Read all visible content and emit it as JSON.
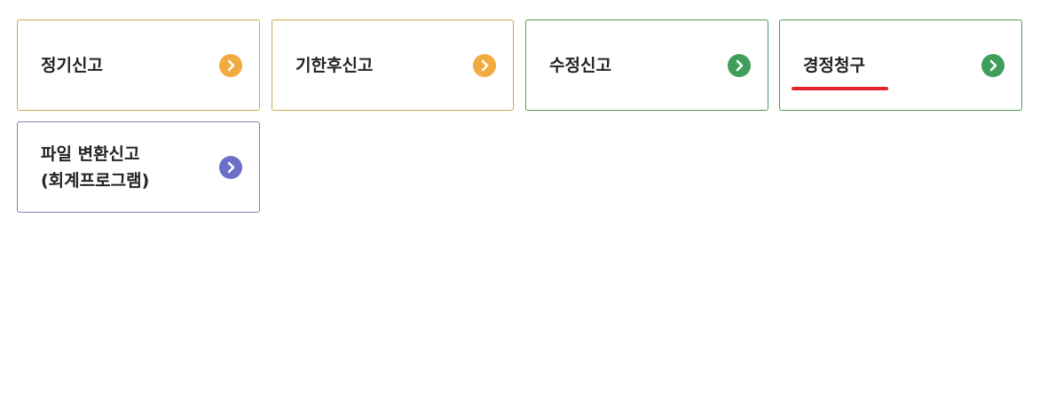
{
  "cards": [
    {
      "lines": [
        "정기신고"
      ],
      "color": "#f2ab3e",
      "theme": "orange",
      "icon": "chevron-right-icon"
    },
    {
      "lines": [
        "기한후신고"
      ],
      "color": "#f2ab3e",
      "theme": "orange",
      "icon": "chevron-right-icon"
    },
    {
      "lines": [
        "수정신고"
      ],
      "color": "#3f9f5a",
      "theme": "green",
      "icon": "chevron-right-icon"
    },
    {
      "lines": [
        "경정청구"
      ],
      "color": "#3f9f5a",
      "theme": "green",
      "icon": "chevron-right-icon",
      "selected": true
    },
    {
      "lines": [
        "파일 변환신고",
        "(회계프로그램)"
      ],
      "color": "#6a6fc8",
      "theme": "purple",
      "icon": "chevron-right-icon"
    }
  ],
  "accent": "#e3262d"
}
